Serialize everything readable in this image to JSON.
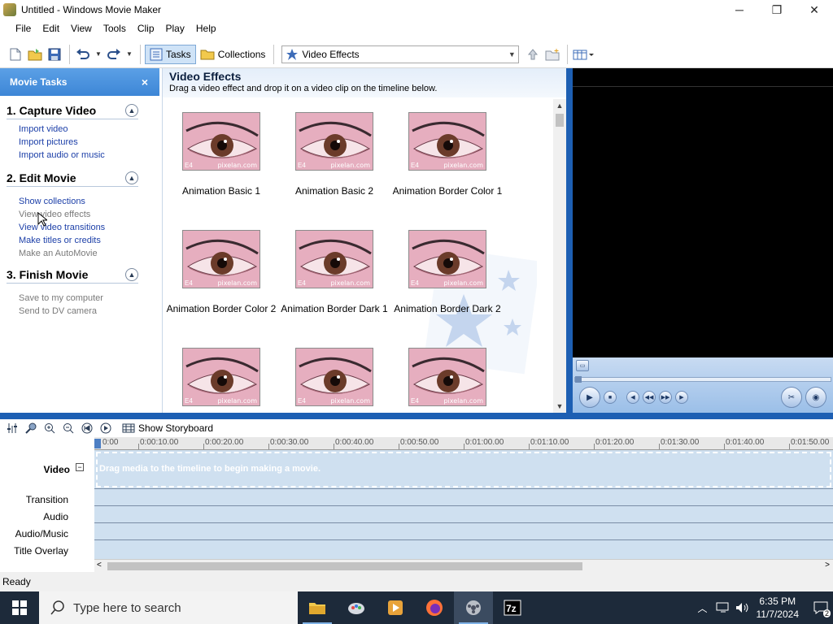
{
  "window": {
    "title": "Untitled - Windows Movie Maker",
    "minimize": "─",
    "maximize": "❐",
    "close": "✕"
  },
  "menu": [
    "File",
    "Edit",
    "View",
    "Tools",
    "Clip",
    "Play",
    "Help"
  ],
  "toolbar": {
    "tasks_label": "Tasks",
    "collections_label": "Collections",
    "collection_select": "Video Effects"
  },
  "tasks_pane": {
    "header": "Movie Tasks",
    "close": "×",
    "sections": [
      {
        "title": "1. Capture Video",
        "items": [
          {
            "label": "Import video",
            "enabled": true
          },
          {
            "label": "Import pictures",
            "enabled": true
          },
          {
            "label": "Import audio or music",
            "enabled": true
          }
        ]
      },
      {
        "title": "2. Edit Movie",
        "items": [
          {
            "label": "Show collections",
            "enabled": true
          },
          {
            "label": "View video effects",
            "enabled": false
          },
          {
            "label": "View video transitions",
            "enabled": true
          },
          {
            "label": "Make titles or credits",
            "enabled": true
          },
          {
            "label": "Make an AutoMovie",
            "enabled": false
          }
        ]
      },
      {
        "title": "3. Finish Movie",
        "items": [
          {
            "label": "Save to my computer",
            "enabled": false
          },
          {
            "label": "Send to DV camera",
            "enabled": false
          }
        ]
      }
    ]
  },
  "effects_pane": {
    "title": "Video Effects",
    "description": "Drag a video effect and drop it on a video clip on the timeline below.",
    "thumb_watermark": "pixelan.com",
    "thumb_tag": "E4",
    "effects": [
      "Animation Basic 1",
      "Animation Basic 2",
      "Animation Border Color 1",
      "Animation Border Color 2",
      "Animation Border Dark 1",
      "Animation Border Dark 2",
      "",
      "",
      ""
    ]
  },
  "timeline": {
    "show_storyboard": "Show Storyboard",
    "tracks": [
      "Video",
      "Transition",
      "Audio",
      "Audio/Music",
      "Title Overlay"
    ],
    "video_hint": "Drag media to the timeline to begin making a movie.",
    "ruler_ticks": [
      "0:00",
      "0:00:10.00",
      "0:00:20.00",
      "0:00:30.00",
      "0:00:40.00",
      "0:00:50.00",
      "0:01:00.00",
      "0:01:10.00",
      "0:01:20.00",
      "0:01:30.00",
      "0:01:40.00",
      "0:01:50.00"
    ]
  },
  "status": "Ready",
  "taskbar": {
    "search_placeholder": "Type here to search",
    "time": "6:35 PM",
    "date": "11/7/2024",
    "notification_count": "2"
  }
}
